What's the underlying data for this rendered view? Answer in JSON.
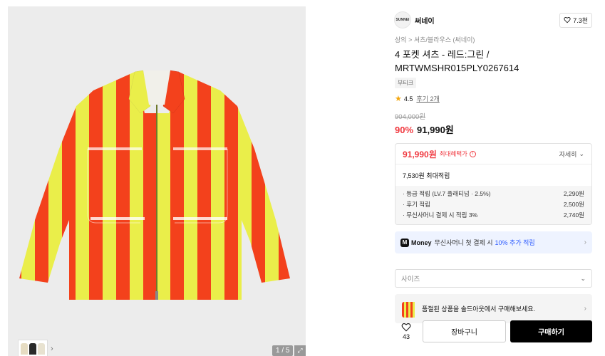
{
  "gallery": {
    "counter": "1 / 5",
    "expand_icon": "expand-icon",
    "jacket_colors": {
      "red": "#f3411c",
      "yellow": "#eaee4a"
    }
  },
  "brand": {
    "logo_text": "SUNNEI",
    "name": "써네이",
    "like_count": "7.3천"
  },
  "breadcrumb": {
    "level1": "상의",
    "separator": ">",
    "level2": "셔츠/블라우스 (써네이)"
  },
  "product": {
    "title": "4 포켓 셔츠 - 레드:그린 / MRTWMSHR015PLY0267614",
    "tag": "부티크",
    "rating": "4.5",
    "reviews": "후기 2개",
    "original_price": "904,000원",
    "discount": "90%",
    "sale_price": "91,990원"
  },
  "benefit": {
    "max_price": "91,990원",
    "max_label": "최대혜택가",
    "detail_label": "자세히",
    "points_label": "7,530원 최대적립",
    "items": [
      {
        "label": "· 등급 적립 (LV.7 플래티넘 · 2.5%)",
        "value": "2,290원"
      },
      {
        "label": "· 후기 적립",
        "value": "2,500원"
      },
      {
        "label": "· 무신사머니 결제 시 적립 3%",
        "value": "2,740원"
      }
    ]
  },
  "money_banner": {
    "logo": "M",
    "brand": "Money",
    "text": "무신사머니 첫 결제 시",
    "accent": "10% 추가 적립"
  },
  "size_select": {
    "placeholder": "사이즈"
  },
  "soldout_banner": {
    "text": "품절된 상품을 솔드아웃에서 구매해보세요."
  },
  "buy_bar": {
    "wish_count": "43",
    "cart_label": "장바구니",
    "buy_label": "구매하기"
  },
  "colors": {
    "accent_red": "#f0373e",
    "accent_blue": "#2d5bff",
    "buy_button": "#000000"
  }
}
